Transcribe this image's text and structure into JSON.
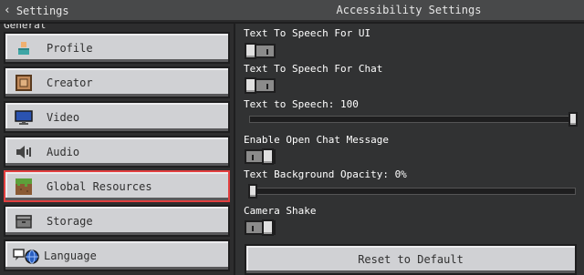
{
  "header": {
    "back_label": "Settings",
    "title": "Accessibility Settings"
  },
  "sidebar": {
    "section_label": "General",
    "items": [
      {
        "label": "Profile",
        "icon": "profile-icon"
      },
      {
        "label": "Creator",
        "icon": "creator-icon"
      },
      {
        "label": "Video",
        "icon": "monitor-icon"
      },
      {
        "label": "Audio",
        "icon": "speaker-icon"
      },
      {
        "label": "Global Resources",
        "icon": "grass-block-icon",
        "selected": true
      },
      {
        "label": "Storage",
        "icon": "storage-icon"
      },
      {
        "label": "Language",
        "icon": "language-icon"
      }
    ]
  },
  "settings": {
    "tts_ui": {
      "label": "Text To Speech For UI",
      "value": false
    },
    "tts_chat": {
      "label": "Text To Speech For Chat",
      "value": false
    },
    "tts_volume": {
      "label": "Text to Speech: 100",
      "value": 100,
      "max": 100
    },
    "open_chat": {
      "label": "Enable Open Chat Message",
      "value": true
    },
    "text_bg_opacity": {
      "label": "Text Background Opacity: 0%",
      "value": 0,
      "max": 100
    },
    "camera_shake": {
      "label": "Camera Shake",
      "value": true
    },
    "reset_label": "Reset to Default"
  },
  "colors": {
    "selected_outline": "#e23f3f",
    "button_face": "#d0d1d4",
    "panel_bg": "#313233"
  }
}
